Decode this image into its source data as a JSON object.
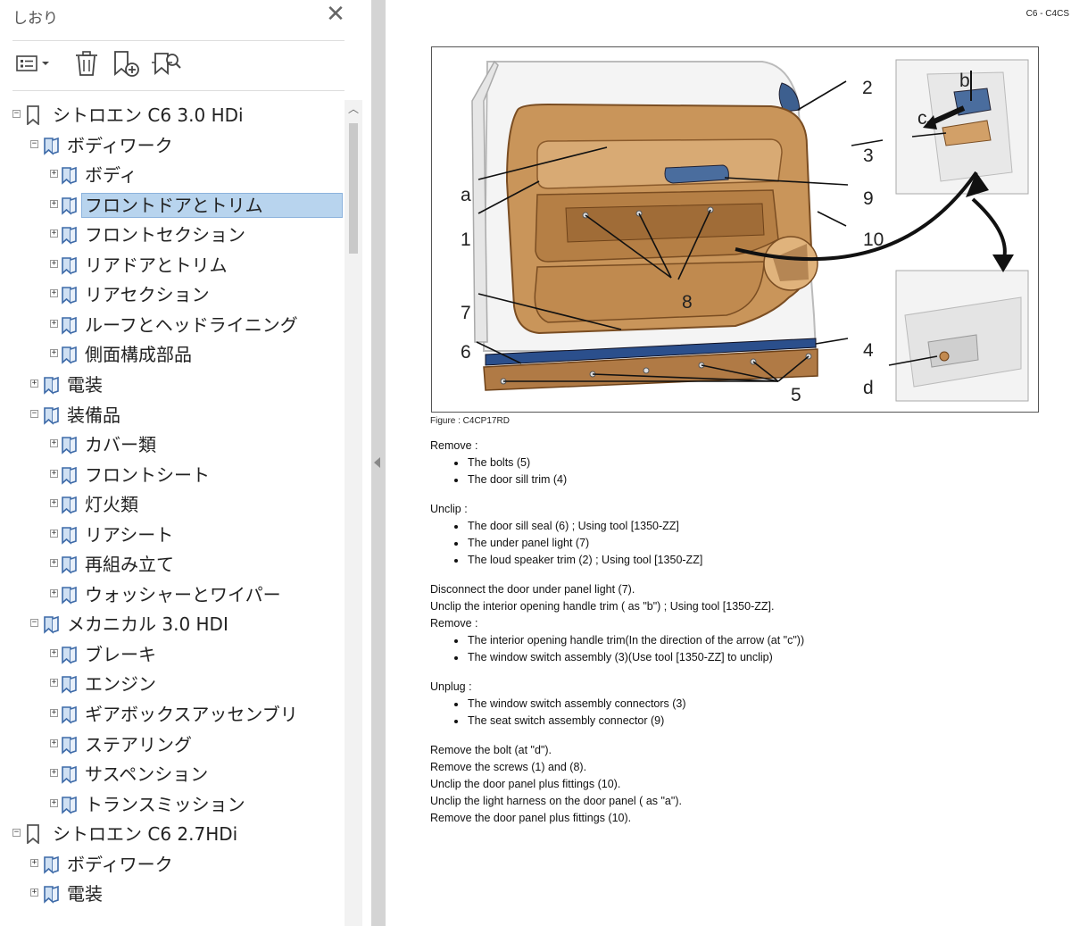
{
  "sidebar": {
    "title": "しおり",
    "close_icon": "close-icon",
    "toolbar": [
      "options-menu-icon",
      "delete-bookmark-icon",
      "new-bookmark-icon",
      "bookmark-search-icon"
    ],
    "tree": [
      {
        "label": "シトロエン C6  3.0 HDi",
        "level": 0,
        "toggle": "⊟",
        "icon": "bookmark-icon"
      },
      {
        "label": "ボディワーク",
        "level": 1,
        "toggle": "⊟",
        "icon": "bookmark-book-icon"
      },
      {
        "label": "ボディ",
        "level": 2,
        "toggle": "⊞",
        "icon": "bookmark-book-icon"
      },
      {
        "label": "フロントドアとトリム",
        "level": 2,
        "toggle": "⊞",
        "icon": "bookmark-book-icon",
        "selected": true
      },
      {
        "label": "フロントセクション",
        "level": 2,
        "toggle": "⊞",
        "icon": "bookmark-book-icon"
      },
      {
        "label": "リアドアとトリム",
        "level": 2,
        "toggle": "⊞",
        "icon": "bookmark-book-icon"
      },
      {
        "label": "リアセクション",
        "level": 2,
        "toggle": "⊞",
        "icon": "bookmark-book-icon"
      },
      {
        "label": "ルーフとヘッドライニング",
        "level": 2,
        "toggle": "⊞",
        "icon": "bookmark-book-icon"
      },
      {
        "label": "側面構成部品",
        "level": 2,
        "toggle": "⊞",
        "icon": "bookmark-book-icon"
      },
      {
        "label": "電装",
        "level": 1,
        "toggle": "⊞",
        "icon": "bookmark-book-icon"
      },
      {
        "label": "装備品",
        "level": 1,
        "toggle": "⊟",
        "icon": "bookmark-book-icon"
      },
      {
        "label": "カバー類",
        "level": 2,
        "toggle": "⊞",
        "icon": "bookmark-book-icon"
      },
      {
        "label": "フロントシート",
        "level": 2,
        "toggle": "⊞",
        "icon": "bookmark-book-icon"
      },
      {
        "label": "灯火類",
        "level": 2,
        "toggle": "⊞",
        "icon": "bookmark-book-icon"
      },
      {
        "label": "リアシート",
        "level": 2,
        "toggle": "⊞",
        "icon": "bookmark-book-icon"
      },
      {
        "label": "再組み立て",
        "level": 2,
        "toggle": "⊞",
        "icon": "bookmark-book-icon"
      },
      {
        "label": "ウォッシャーとワイパー",
        "level": 2,
        "toggle": "⊞",
        "icon": "bookmark-book-icon"
      },
      {
        "label": "メカニカル 3.0 HDI",
        "level": 1,
        "toggle": "⊟",
        "icon": "bookmark-book-icon"
      },
      {
        "label": "ブレーキ",
        "level": 2,
        "toggle": "⊞",
        "icon": "bookmark-book-icon"
      },
      {
        "label": "エンジン",
        "level": 2,
        "toggle": "⊞",
        "icon": "bookmark-book-icon"
      },
      {
        "label": "ギアボックスアッセンブリ",
        "level": 2,
        "toggle": "⊞",
        "icon": "bookmark-book-icon"
      },
      {
        "label": "ステアリング",
        "level": 2,
        "toggle": "⊞",
        "icon": "bookmark-book-icon"
      },
      {
        "label": "サスペンション",
        "level": 2,
        "toggle": "⊞",
        "icon": "bookmark-book-icon"
      },
      {
        "label": "トランスミッション",
        "level": 2,
        "toggle": "⊞",
        "icon": "bookmark-book-icon"
      },
      {
        "label": "シトロエン C6  2.7HDi",
        "level": 0,
        "toggle": "⊟",
        "icon": "bookmark-icon"
      },
      {
        "label": "ボディワーク",
        "level": 1,
        "toggle": "⊞",
        "icon": "bookmark-book-icon"
      },
      {
        "label": "電装",
        "level": 1,
        "toggle": "⊞",
        "icon": "bookmark-book-icon"
      }
    ]
  },
  "document": {
    "header_code": "C6 - C4CS",
    "figure_caption": "Figure : C4CP17RD",
    "figure_callouts": [
      "2",
      "b",
      "c",
      "3",
      "a",
      "9",
      "1",
      "10",
      "8",
      "7",
      "6",
      "4",
      "d",
      "5"
    ],
    "blocks": [
      {
        "type": "p",
        "text": "Remove :"
      },
      {
        "type": "li",
        "text": "The bolts (5)"
      },
      {
        "type": "li",
        "text": "The door sill trim (4)"
      },
      {
        "type": "gap"
      },
      {
        "type": "p",
        "text": "Unclip :"
      },
      {
        "type": "li",
        "text": "The door sill seal (6) ; Using tool [1350-ZZ]"
      },
      {
        "type": "li",
        "text": "The under panel light (7)"
      },
      {
        "type": "li",
        "text": "The loud speaker trim (2) ; Using tool [1350-ZZ]"
      },
      {
        "type": "gap"
      },
      {
        "type": "p",
        "text": "Disconnect the door under panel light (7)."
      },
      {
        "type": "p",
        "text": "Unclip the interior opening handle trim ( as \"b\") ; Using tool [1350-ZZ]."
      },
      {
        "type": "p",
        "text": "Remove :"
      },
      {
        "type": "li",
        "text": "The interior opening handle trim(In the direction of the arrow  (at \"c\"))"
      },
      {
        "type": "li",
        "text": "The window switch assembly (3)(Use tool [1350-ZZ] to unclip)"
      },
      {
        "type": "gap"
      },
      {
        "type": "p",
        "text": "Unplug :"
      },
      {
        "type": "li",
        "text": "The window switch assembly connectors (3)"
      },
      {
        "type": "li",
        "text": "The seat switch assembly connector (9)"
      },
      {
        "type": "gap"
      },
      {
        "type": "p",
        "text": "Remove the bolt  (at \"d\")."
      },
      {
        "type": "p",
        "text": "Remove the screws (1) and (8)."
      },
      {
        "type": "p",
        "text": "Unclip the door panel plus fittings (10)."
      },
      {
        "type": "p",
        "text": "Unclip the light harness on the door panel ( as \"a\")."
      },
      {
        "type": "p",
        "text": "Remove the door panel plus fittings (10)."
      }
    ]
  },
  "colors": {
    "selection_bg": "#b8d4ee",
    "trim_tan": "#c9955a",
    "trim_dark": "#8a5a2b",
    "sill_blue": "#2b4f8c"
  }
}
